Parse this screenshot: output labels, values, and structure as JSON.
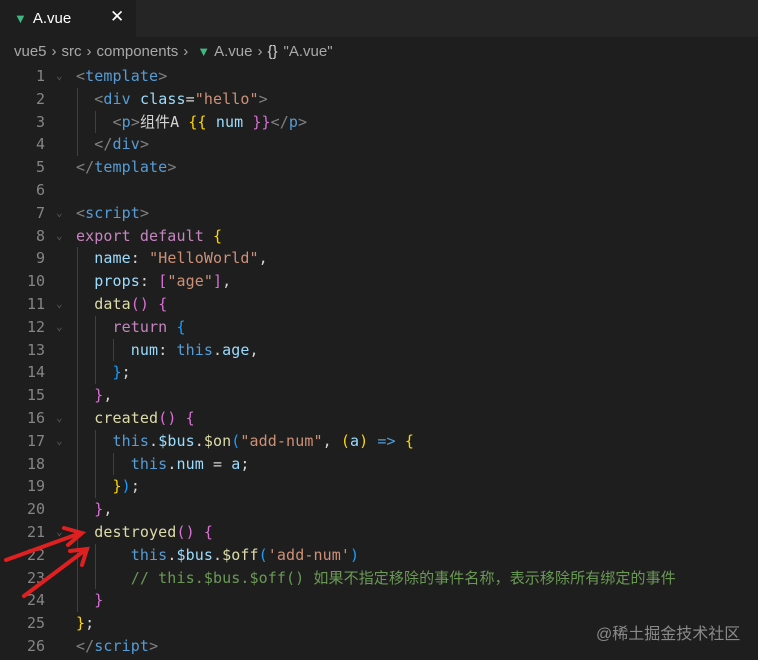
{
  "tab": {
    "label": "A.vue",
    "icon": "vue-icon",
    "close": "✕"
  },
  "breadcrumb": [
    "vue5",
    "src",
    "components",
    "A.vue",
    "{}",
    "\"A.vue\""
  ],
  "folded_lines": [
    1,
    7,
    8,
    11,
    12,
    16,
    17,
    21
  ],
  "code_lines": [
    [
      [
        "<",
        "t"
      ],
      [
        "template",
        "tn"
      ],
      [
        ">",
        "t"
      ]
    ],
    [
      [
        "  ",
        "w"
      ],
      [
        "<",
        "t"
      ],
      [
        "div",
        "tn"
      ],
      [
        " ",
        "w"
      ],
      [
        "class",
        "at"
      ],
      [
        "=",
        "w"
      ],
      [
        "\"hello\"",
        "s"
      ],
      [
        ">",
        "t"
      ]
    ],
    [
      [
        "    ",
        "w"
      ],
      [
        "<",
        "t"
      ],
      [
        "p",
        "tn"
      ],
      [
        ">",
        "t"
      ],
      [
        "组件A ",
        "w"
      ],
      [
        "{{",
        "y"
      ],
      [
        " num ",
        "v"
      ],
      [
        "}}",
        "p"
      ],
      [
        "</",
        "t"
      ],
      [
        "p",
        "tn"
      ],
      [
        ">",
        "t"
      ]
    ],
    [
      [
        "  ",
        "w"
      ],
      [
        "</",
        "t"
      ],
      [
        "div",
        "tn"
      ],
      [
        ">",
        "t"
      ]
    ],
    [
      [
        "</",
        "t"
      ],
      [
        "template",
        "tn"
      ],
      [
        ">",
        "t"
      ]
    ],
    [],
    [
      [
        "<",
        "t"
      ],
      [
        "script",
        "tn"
      ],
      [
        ">",
        "t"
      ]
    ],
    [
      [
        "export default ",
        "k"
      ],
      [
        "{",
        "y"
      ]
    ],
    [
      [
        "  name",
        "v"
      ],
      [
        ": ",
        "w"
      ],
      [
        "\"HelloWorld\"",
        "s"
      ],
      [
        ",",
        "w"
      ]
    ],
    [
      [
        "  props",
        "v"
      ],
      [
        ": ",
        "w"
      ],
      [
        "[",
        "p"
      ],
      [
        "\"age\"",
        "s"
      ],
      [
        "]",
        "p"
      ],
      [
        ",",
        "w"
      ]
    ],
    [
      [
        "  data",
        "f"
      ],
      [
        "()",
        "p"
      ],
      [
        " ",
        "w"
      ],
      [
        "{",
        "p"
      ]
    ],
    [
      [
        "    return ",
        "k"
      ],
      [
        "{",
        "b"
      ]
    ],
    [
      [
        "      num",
        "v"
      ],
      [
        ": ",
        "w"
      ],
      [
        "this",
        "th"
      ],
      [
        ".",
        "w"
      ],
      [
        "age",
        "v"
      ],
      [
        ",",
        "w"
      ]
    ],
    [
      [
        "    ",
        "w"
      ],
      [
        "}",
        "b"
      ],
      [
        ";",
        "w"
      ]
    ],
    [
      [
        "  ",
        "w"
      ],
      [
        "}",
        "p"
      ],
      [
        ",",
        "w"
      ]
    ],
    [
      [
        "  created",
        "f"
      ],
      [
        "()",
        "p"
      ],
      [
        " ",
        "w"
      ],
      [
        "{",
        "p"
      ]
    ],
    [
      [
        "    this",
        "th"
      ],
      [
        ".",
        "w"
      ],
      [
        "$bus",
        "v"
      ],
      [
        ".",
        "w"
      ],
      [
        "$on",
        "f"
      ],
      [
        "(",
        "b"
      ],
      [
        "\"add-num\"",
        "s"
      ],
      [
        ", ",
        "w"
      ],
      [
        "(",
        "y"
      ],
      [
        "a",
        "v"
      ],
      [
        ")",
        "y"
      ],
      [
        " => ",
        "th"
      ],
      [
        "{",
        "y"
      ]
    ],
    [
      [
        "      this",
        "th"
      ],
      [
        ".",
        "w"
      ],
      [
        "num",
        "v"
      ],
      [
        " = ",
        "w"
      ],
      [
        "a",
        "v"
      ],
      [
        ";",
        "w"
      ]
    ],
    [
      [
        "    ",
        "w"
      ],
      [
        "}",
        "y"
      ],
      [
        ")",
        "b"
      ],
      [
        ";",
        "w"
      ]
    ],
    [
      [
        "  ",
        "w"
      ],
      [
        "}",
        "p"
      ],
      [
        ",",
        "w"
      ]
    ],
    [
      [
        "  destroyed",
        "f"
      ],
      [
        "()",
        "p"
      ],
      [
        " ",
        "w"
      ],
      [
        "{",
        "p"
      ]
    ],
    [
      [
        "      this",
        "th"
      ],
      [
        ".",
        "w"
      ],
      [
        "$bus",
        "v"
      ],
      [
        ".",
        "w"
      ],
      [
        "$off",
        "f"
      ],
      [
        "(",
        "b"
      ],
      [
        "'add-num'",
        "s"
      ],
      [
        ")",
        "b"
      ]
    ],
    [
      [
        "      // this.$bus.$off() 如果不指定移除的事件名称，表示移除所有绑定的事件",
        "c"
      ]
    ],
    [
      [
        "  ",
        "w"
      ],
      [
        "}",
        "p"
      ]
    ],
    [
      [
        "}",
        "y"
      ],
      [
        ";",
        "w"
      ]
    ],
    [
      [
        "</",
        "t"
      ],
      [
        "script",
        "tn"
      ],
      [
        ">",
        "t"
      ]
    ]
  ],
  "annotation_color": "#e02020",
  "watermark": "@稀土掘金技术社区"
}
